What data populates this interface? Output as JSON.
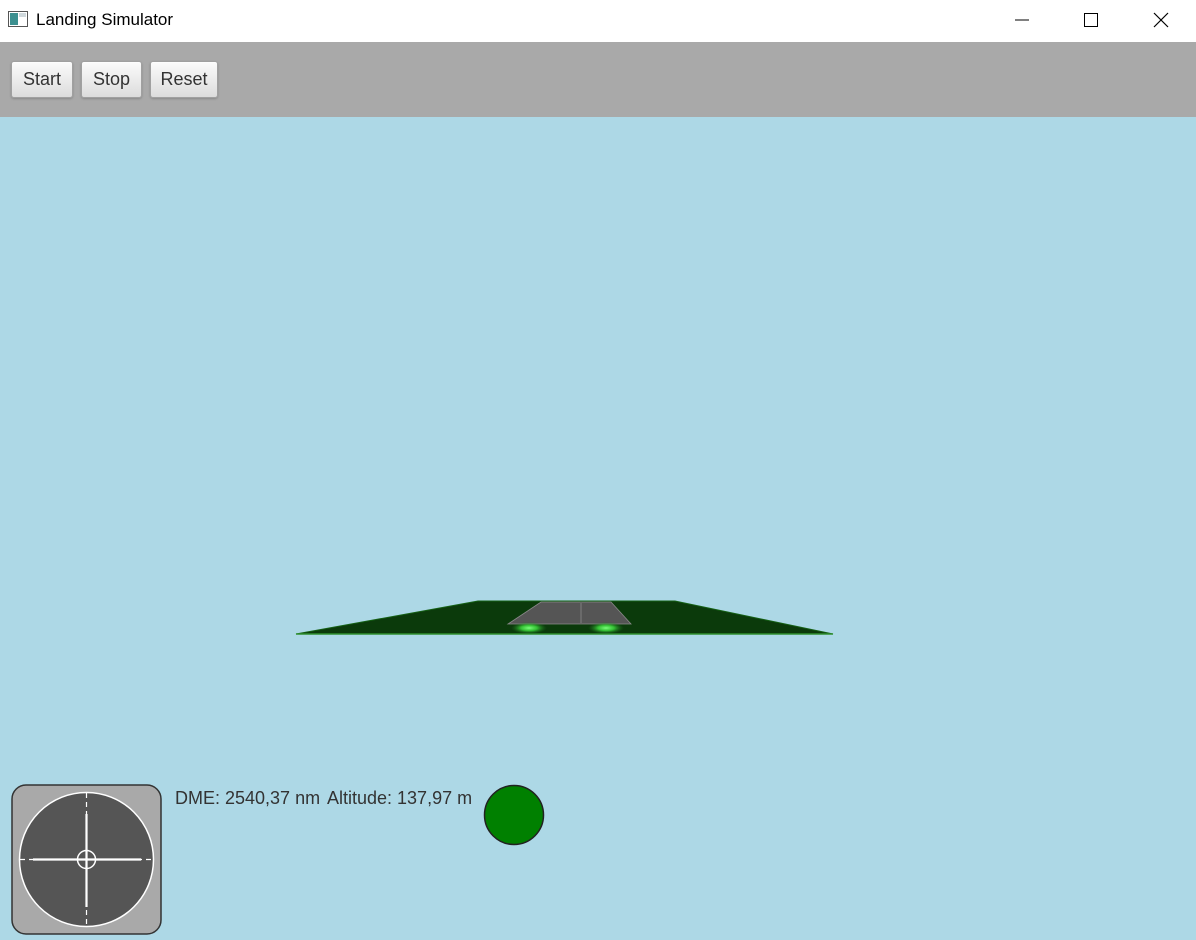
{
  "window": {
    "title": "Landing Simulator",
    "controls": {
      "minimize_icon": "minimize-icon",
      "maximize_icon": "maximize-icon",
      "close_icon": "close-icon"
    }
  },
  "toolbar": {
    "buttons": [
      {
        "label": "Start"
      },
      {
        "label": "Stop"
      },
      {
        "label": "Reset"
      }
    ]
  },
  "scene": {
    "sky_color": "#add8e6",
    "ground_color": "#0b3a0b",
    "runway_color": "#555555",
    "approach_light_color": "#44dd44"
  },
  "hud": {
    "dme_text": "DME: 2540,37 nm",
    "altitude_text": "Altitude: 137,97 m",
    "status_light_color": "#008000",
    "ils_indicator_icon": "crosshair-icon"
  }
}
